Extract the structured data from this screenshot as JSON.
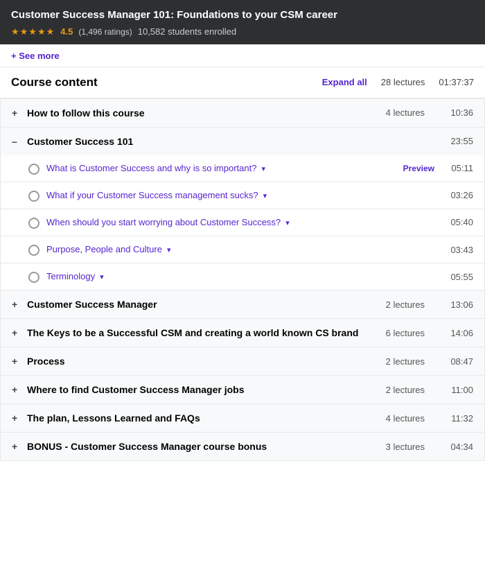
{
  "header": {
    "title": "Customer Success Manager 101: Foundations to your CSM career",
    "rating_score": "4.5",
    "rating_count": "(1,496 ratings)",
    "enrolled": "10,582 students enrolled",
    "stars": "★★★★★"
  },
  "see_more": "+ See more",
  "course_content": {
    "title": "Course content",
    "expand_all": "Expand all",
    "total_lectures": "28 lectures",
    "total_time": "01:37:37"
  },
  "sections": [
    {
      "toggle": "+",
      "name": "How to follow this course",
      "lectures": "4 lectures",
      "time": "10:36",
      "expanded": false
    },
    {
      "toggle": "–",
      "name": "Customer Success 101",
      "lectures": "",
      "time": "23:55",
      "expanded": true,
      "lessons": [
        {
          "title": "What is Customer Success and why is so important?",
          "has_dropdown": true,
          "preview": "Preview",
          "time": "05:11"
        },
        {
          "title": "What if your Customer Success management sucks?",
          "has_dropdown": true,
          "preview": "",
          "time": "03:26"
        },
        {
          "title": "When should you start worrying about Customer Success?",
          "has_dropdown": true,
          "preview": "",
          "time": "05:40"
        },
        {
          "title": "Purpose, People and Culture",
          "has_dropdown": true,
          "preview": "",
          "time": "03:43"
        },
        {
          "title": "Terminology",
          "has_dropdown": true,
          "preview": "",
          "time": "05:55"
        }
      ]
    },
    {
      "toggle": "+",
      "name": "Customer Success Manager",
      "lectures": "2 lectures",
      "time": "13:06",
      "expanded": false
    },
    {
      "toggle": "+",
      "name": "The Keys to be a Successful CSM and creating a world known CS brand",
      "lectures": "6 lectures",
      "time": "14:06",
      "expanded": false
    },
    {
      "toggle": "+",
      "name": "Process",
      "lectures": "2 lectures",
      "time": "08:47",
      "expanded": false
    },
    {
      "toggle": "+",
      "name": "Where to find Customer Success Manager jobs",
      "lectures": "2 lectures",
      "time": "11:00",
      "expanded": false
    },
    {
      "toggle": "+",
      "name": "The plan, Lessons Learned and FAQs",
      "lectures": "4 lectures",
      "time": "11:32",
      "expanded": false
    },
    {
      "toggle": "+",
      "name": "BONUS - Customer Success Manager course bonus",
      "lectures": "3 lectures",
      "time": "04:34",
      "expanded": false
    }
  ]
}
